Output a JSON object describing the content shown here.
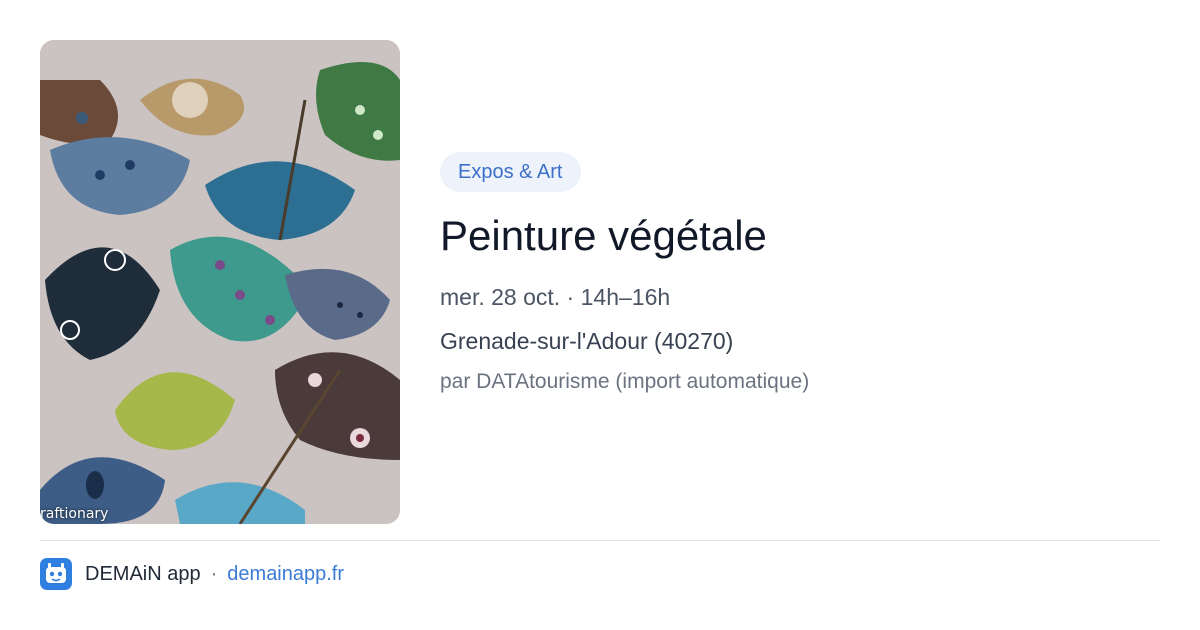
{
  "card": {
    "image_watermark": "raftionary",
    "category": "Expos & Art",
    "title": "Peinture végétale",
    "date": "mer. 28 oct. · 14h–16h",
    "location": "Grenade-sur-l'Adour (40270)",
    "source": "par DATAtourisme (import automatique)"
  },
  "footer": {
    "app_name": "DEMAiN app",
    "separator": "·",
    "link": "demainapp.fr"
  },
  "icons": {
    "app_logo": "demain-app-logo-icon"
  },
  "colors": {
    "accent_blue": "#3b6fc8",
    "pill_background": "#eef3fb",
    "link_blue": "#3b7bd6",
    "logo_blue": "#2f7fe0"
  }
}
